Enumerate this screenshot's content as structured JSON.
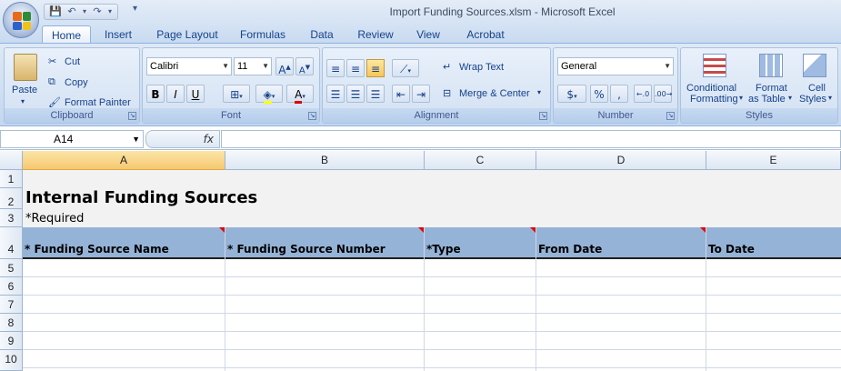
{
  "window": {
    "title": "Import Funding Sources.xlsm - Microsoft Excel"
  },
  "tabs": [
    "Home",
    "Insert",
    "Page Layout",
    "Formulas",
    "Data",
    "Review",
    "View",
    "Acrobat"
  ],
  "ribbon": {
    "clipboard": {
      "paste": "Paste",
      "cut": "Cut",
      "copy": "Copy",
      "format_painter": "Format Painter",
      "label": "Clipboard"
    },
    "font": {
      "family": "Calibri",
      "size": "11",
      "label": "Font",
      "bold": "B",
      "italic": "I",
      "underline": "U"
    },
    "alignment": {
      "wrap": "Wrap Text",
      "merge": "Merge & Center",
      "label": "Alignment"
    },
    "number": {
      "format": "General",
      "currency": "$",
      "percent": "%",
      "comma": ",",
      "label": "Number"
    },
    "styles": {
      "conditional_1": "Conditional",
      "conditional_2": "Formatting",
      "table_1": "Format",
      "table_2": "as Table",
      "cell_1": "Cell",
      "cell_2": "Styles",
      "label": "Styles"
    }
  },
  "formula_bar": {
    "name_box": "A14",
    "fx": "fx",
    "content": ""
  },
  "columns": [
    "A",
    "B",
    "C",
    "D",
    "E"
  ],
  "rows": [
    "1",
    "2",
    "3",
    "4",
    "5",
    "6",
    "7",
    "8",
    "9",
    "10"
  ],
  "sheet": {
    "title": "Internal Funding Sources",
    "required_note": "*Required",
    "headers": [
      "* Funding Source Name",
      "* Funding Source Number",
      "*Type",
      "From Date",
      "To Date"
    ]
  },
  "colors": {
    "header_fill": "#95B3D7",
    "band_fill": "#F2F2F2",
    "comment_marker": "#E00000"
  }
}
